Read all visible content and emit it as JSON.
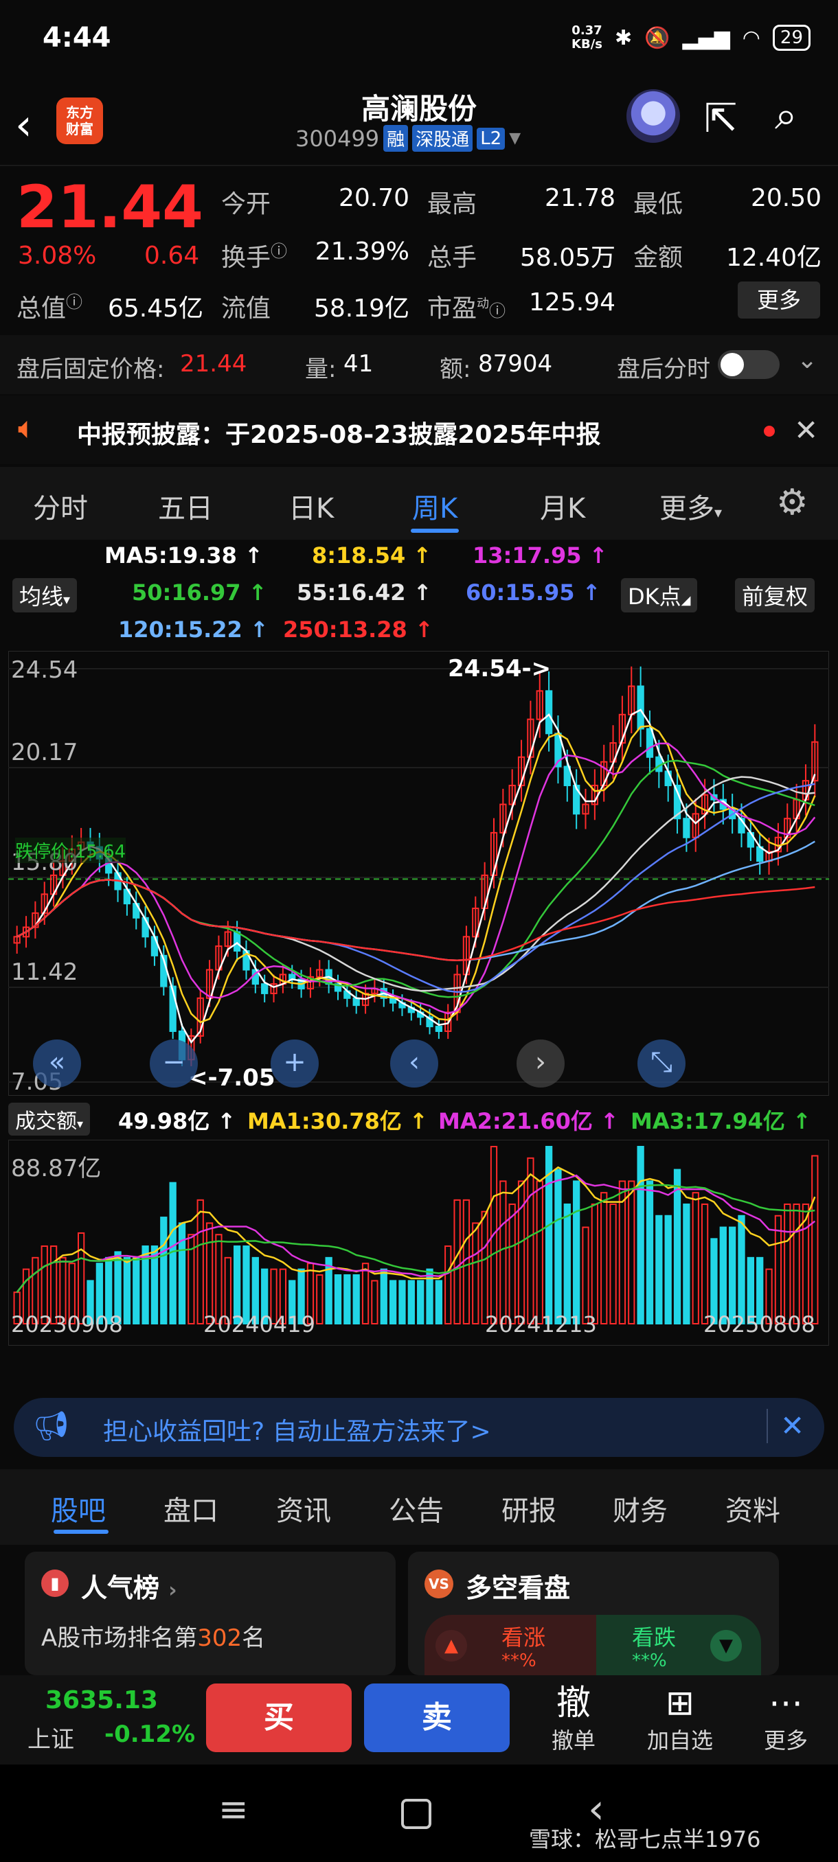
{
  "status": {
    "time": "4:44",
    "speed_top": "0.37",
    "speed_bottom": "KB/s",
    "battery": "29"
  },
  "header": {
    "logo_line1": "东方",
    "logo_line2": "财富",
    "stock_name": "高澜股份",
    "stock_code": "300499",
    "tags": [
      "融",
      "深股通",
      "L2"
    ]
  },
  "quote": {
    "price": "21.44",
    "change_pct": "3.08%",
    "change": "0.64",
    "open_label": "今开",
    "open": "20.70",
    "high_label": "最高",
    "high": "21.78",
    "low_label": "最低",
    "low": "20.50",
    "turnover_label": "换手",
    "turnover": "21.39%",
    "volume_label": "总手",
    "volume": "58.05万",
    "amount_label": "金额",
    "amount": "12.40亿",
    "mktcap_label": "总值",
    "mktcap": "65.45亿",
    "float_label": "流值",
    "float": "58.19亿",
    "pe_label": "市盈",
    "pe_sup": "动",
    "pe": "125.94",
    "more_label": "更多"
  },
  "after_hours": {
    "price_label": "盘后固定价格:",
    "price": "21.44",
    "vol_label": "量:",
    "vol": "41",
    "amt_label": "额:",
    "amt": "87904",
    "timeshare_label": "盘后分时"
  },
  "notice": {
    "text": "中报预披露：于2025-08-23披露2025年中报"
  },
  "ktabs": [
    "分时",
    "五日",
    "日K",
    "周K",
    "月K",
    "更多"
  ],
  "ma_legend": {
    "ma5": "MA5:19.38",
    "ma8": "8:18.54",
    "ma13": "13:17.95",
    "ma50": "50:16.97",
    "ma55": "55:16.42",
    "ma60": "60:15.95",
    "ma120": "120:15.22",
    "ma250": "250:13.28",
    "indicator": "均线",
    "dk": "DK点",
    "adjust": "前复权"
  },
  "colors": {
    "up": "#ff2a2a",
    "down": "#22d6e6",
    "accent": "#3d8cff"
  },
  "chart_data": {
    "type": "candlestick",
    "ylim": [
      7.05,
      24.54
    ],
    "ytick_labels": [
      "24.54",
      "20.17",
      "15.80",
      "11.42",
      "7.05"
    ],
    "limit_label": "跌停价:15.64",
    "limit_value": 15.64,
    "max_annotation": "24.54->",
    "min_annotation": "<-7.05",
    "dates": [
      "20230908",
      "20240419",
      "20241213",
      "20250808"
    ],
    "close": [
      13.2,
      13.6,
      14.2,
      15.0,
      15.8,
      16.4,
      16.9,
      17.2,
      17.0,
      16.5,
      15.9,
      15.2,
      14.6,
      14.0,
      13.2,
      12.4,
      11.1,
      9.2,
      8.0,
      9.0,
      10.6,
      11.8,
      12.8,
      13.4,
      12.6,
      11.8,
      11.2,
      10.8,
      11.2,
      11.6,
      11.4,
      11.0,
      11.5,
      11.8,
      11.2,
      10.9,
      10.6,
      10.3,
      10.8,
      11.0,
      10.6,
      10.4,
      10.2,
      10.0,
      9.8,
      9.4,
      9.2,
      10.0,
      11.6,
      13.2,
      14.4,
      15.8,
      17.6,
      18.8,
      19.6,
      20.8,
      22.4,
      23.6,
      21.8,
      20.4,
      19.6,
      18.4,
      18.8,
      19.6,
      20.6,
      21.4,
      22.6,
      23.8,
      22.0,
      20.8,
      20.2,
      19.6,
      18.2,
      17.4,
      18.4,
      19.2,
      19.0,
      18.6,
      18.2,
      17.6,
      17.0,
      16.4,
      16.8,
      17.4,
      18.2,
      19.0,
      19.8,
      21.44
    ],
    "volume_ylim_label": "88.87亿",
    "volume_legend": {
      "name": "成交额",
      "value": "49.98亿",
      "ma1": "MA1:30.78亿",
      "ma2": "MA2:21.60亿",
      "ma3": "MA3:17.94亿"
    }
  },
  "banner": {
    "text": "担心收益回吐? 自动止盈方法来了>"
  },
  "btabs": [
    "股吧",
    "盘口",
    "资讯",
    "公告",
    "研报",
    "财务",
    "资料"
  ],
  "popularity": {
    "title": "人气榜",
    "rank_prefix": "A股市场排名第",
    "rank": "302",
    "rank_suffix": "名"
  },
  "bullbear": {
    "title": "多空看盘",
    "up": "看涨",
    "down": "看跌",
    "up_pct": "**%",
    "down_pct": "**%"
  },
  "bottom": {
    "index_value": "3635.13",
    "index_name": "上证",
    "index_change": "-0.12%",
    "buy": "买",
    "sell": "卖",
    "cancel": "撤单",
    "cancel_icon": "撤",
    "add": "加自选",
    "more": "更多"
  },
  "watermark": "雪球：松哥七点半1976"
}
